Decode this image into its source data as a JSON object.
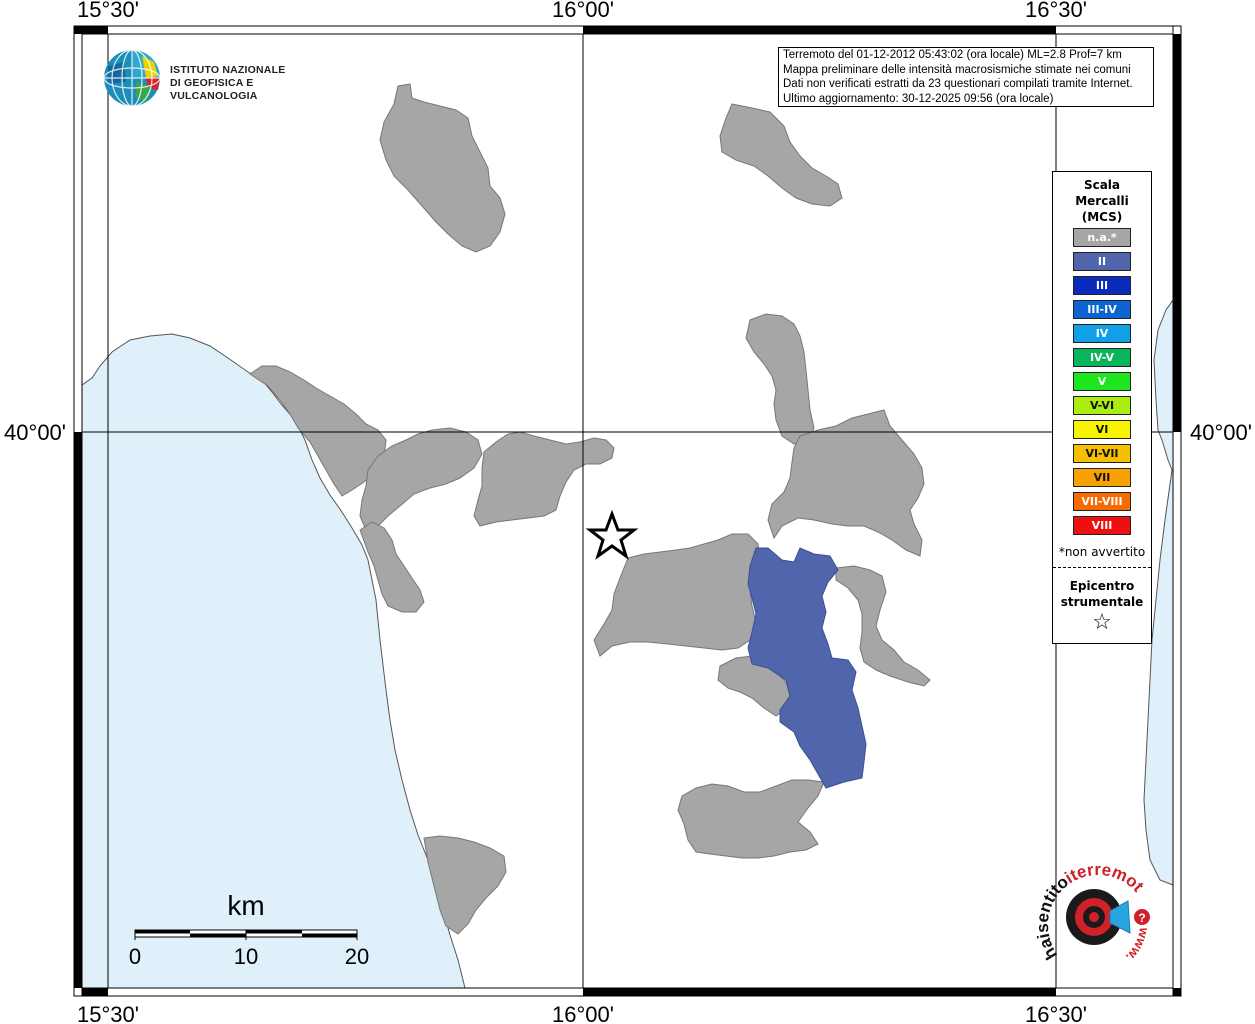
{
  "map": {
    "lon_labels_top": [
      "15°30'",
      "16°00'",
      "16°30'"
    ],
    "lon_labels_bottom": [
      "15°30'",
      "16°00'",
      "16°30'"
    ],
    "lat_label_left": "40°00'",
    "lat_label_right": "40°00'",
    "colors": {
      "sea": "#dff0fb",
      "coast": "#555555",
      "not_available": "#a6a6a6",
      "intensity_II": "#5165ad",
      "graticule": "#000000"
    }
  },
  "info": {
    "line1": "Terremoto del 01-12-2012 05:43:02 (ora locale) ML=2.8 Prof=7 km",
    "line2": "Mappa preliminare delle intensità macrosismiche stimate nei comuni",
    "line3": "Dati non verificati estratti da 23 questionari compilati tramite Internet.",
    "line4": "Ultimo aggiornamento: 30-12-2025 09:56 (ora locale)"
  },
  "logo": {
    "line1": "ISTITUTO NAZIONALE",
    "line2": "DI GEOFISICA E VULCANOLOGIA"
  },
  "legend": {
    "title1": "Scala",
    "title2": "Mercalli",
    "title3": "(MCS)",
    "items": [
      {
        "label": "n.a.*",
        "color": "#a6a6a6"
      },
      {
        "label": "II",
        "color": "#5165ad"
      },
      {
        "label": "III",
        "color": "#0b2bbd"
      },
      {
        "label": "III-IV",
        "color": "#0a64d2"
      },
      {
        "label": "IV",
        "color": "#0fa0e8"
      },
      {
        "label": "IV-V",
        "color": "#09b45a"
      },
      {
        "label": "V",
        "color": "#1ee61e"
      },
      {
        "label": "V-VI",
        "color": "#aaee10"
      },
      {
        "label": "VI",
        "color": "#f8f400"
      },
      {
        "label": "VI-VII",
        "color": "#f6c000"
      },
      {
        "label": "VII",
        "color": "#f6a200"
      },
      {
        "label": "VII-VIII",
        "color": "#f66a00"
      },
      {
        "label": "VIII",
        "color": "#ee1010"
      }
    ],
    "note": "*non avvertito",
    "epicentre1": "Epicentro",
    "epicentre2": "strumentale",
    "star": "☆"
  },
  "scalebar": {
    "unit": "km",
    "ticks": [
      "0",
      "10",
      "20"
    ]
  },
  "brand": {
    "word1": "haisentito",
    "word2": "iterremoto.it",
    "word3": "www."
  }
}
